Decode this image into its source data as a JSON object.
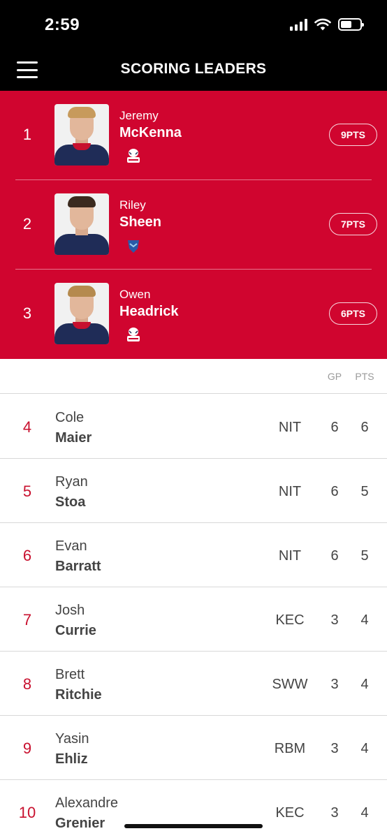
{
  "status_bar": {
    "time": "2:59"
  },
  "nav": {
    "title": "SCORING LEADERS"
  },
  "top_leaders": [
    {
      "rank": "1",
      "first_name": "Jeremy",
      "last_name": "McKenna",
      "points": "9PTS",
      "team_logo": "ice-tigers-logo",
      "hair_color": "#c79a5c"
    },
    {
      "rank": "2",
      "first_name": "Riley",
      "last_name": "Sheen",
      "points": "7PTS",
      "team_logo": "schwenninger-wild-wings-logo",
      "hair_color": "#3b2a1f"
    },
    {
      "rank": "3",
      "first_name": "Owen",
      "last_name": "Headrick",
      "points": "6PTS",
      "team_logo": "ice-tigers-logo",
      "hair_color": "#b58a4e"
    }
  ],
  "table": {
    "headers": {
      "gp": "GP",
      "pts": "PTS"
    },
    "rows": [
      {
        "rank": "4",
        "first_name": "Cole",
        "last_name": "Maier",
        "team": "NIT",
        "gp": "6",
        "pts": "6"
      },
      {
        "rank": "5",
        "first_name": "Ryan",
        "last_name": "Stoa",
        "team": "NIT",
        "gp": "6",
        "pts": "5"
      },
      {
        "rank": "6",
        "first_name": "Evan",
        "last_name": "Barratt",
        "team": "NIT",
        "gp": "6",
        "pts": "5"
      },
      {
        "rank": "7",
        "first_name": "Josh",
        "last_name": "Currie",
        "team": "KEC",
        "gp": "3",
        "pts": "4"
      },
      {
        "rank": "8",
        "first_name": "Brett",
        "last_name": "Ritchie",
        "team": "SWW",
        "gp": "3",
        "pts": "4"
      },
      {
        "rank": "9",
        "first_name": "Yasin",
        "last_name": "Ehliz",
        "team": "RBM",
        "gp": "3",
        "pts": "4"
      },
      {
        "rank": "10",
        "first_name": "Alexandre",
        "last_name": "Grenier",
        "team": "KEC",
        "gp": "3",
        "pts": "4"
      }
    ]
  },
  "colors": {
    "accent": "#d0052f",
    "rank_red": "#c8102e",
    "text": "#444444",
    "muted": "#9a9a9a"
  },
  "icons": {
    "menu": "hamburger-menu-icon",
    "signal": "cellular-signal-icon",
    "wifi": "wifi-icon",
    "battery": "battery-icon"
  }
}
